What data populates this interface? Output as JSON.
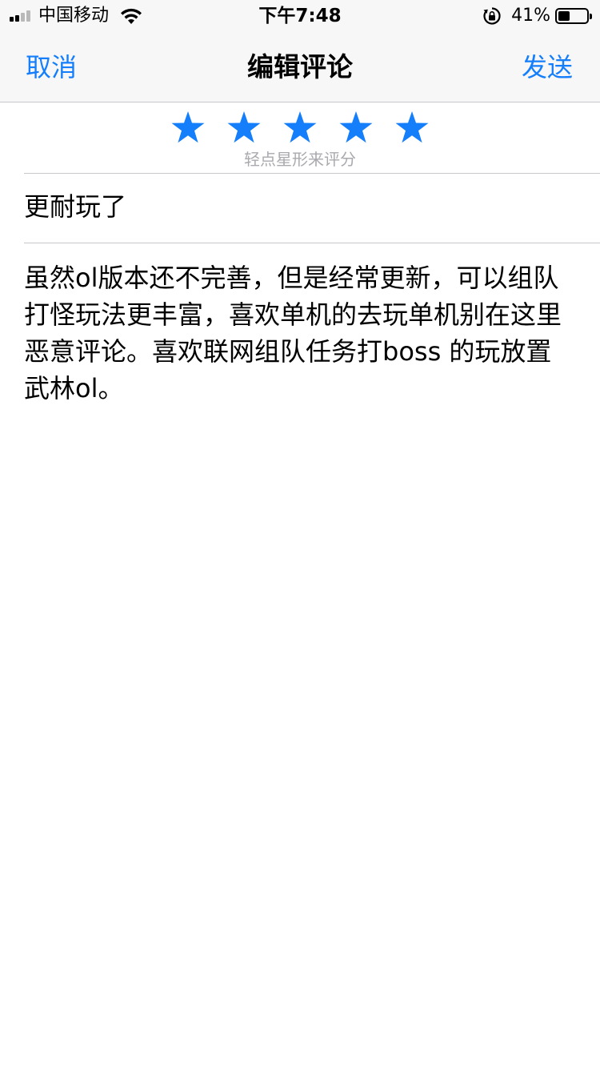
{
  "status_bar": {
    "carrier": "中国移动",
    "time": "下午7:48",
    "battery_percent": "41%",
    "battery_level": 0.41,
    "signal_bars_filled": 2,
    "signal_bars_total": 4,
    "icons": [
      "signal-icon",
      "wifi-icon",
      "rotation-lock-icon",
      "battery-icon"
    ]
  },
  "nav": {
    "cancel_label": "取消",
    "title": "编辑评论",
    "send_label": "发送",
    "accent_color": "#157efb"
  },
  "rating": {
    "stars": 5,
    "max_stars": 5,
    "hint": "轻点星形来评分",
    "star_color": "#157efb"
  },
  "review": {
    "title": "更耐玩了",
    "body": "虽然ol版本还不完善，但是经常更新，可以组队打怪玩法更丰富，喜欢单机的去玩单机别在这里恶意评论。喜欢联网组队任务打boss 的玩放置武林ol。"
  }
}
